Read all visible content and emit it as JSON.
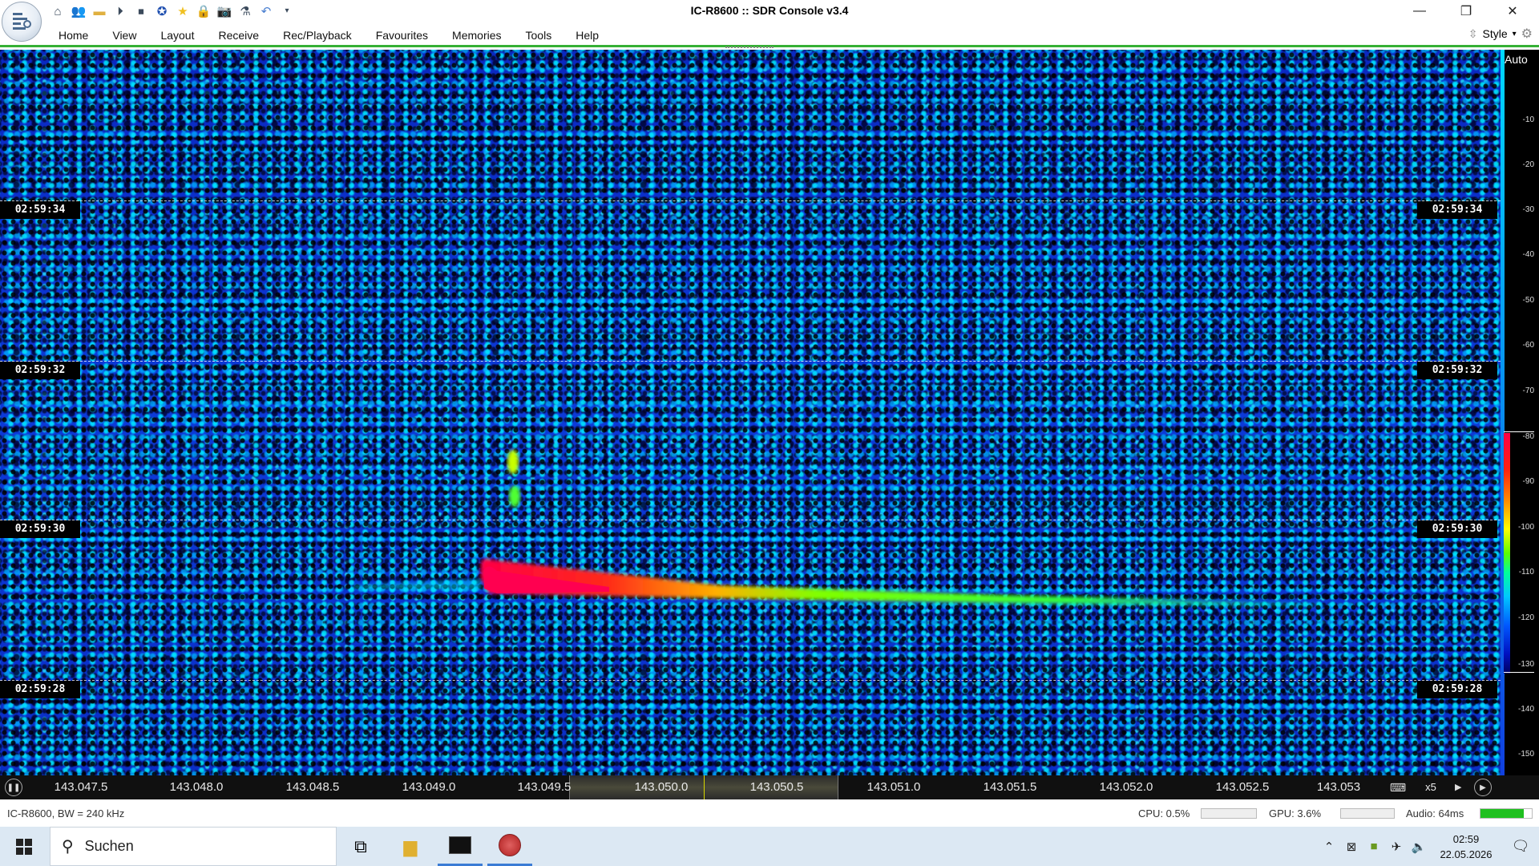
{
  "window": {
    "title": "IC-R8600 :: SDR Console v3.4",
    "minimize_icon": "minimize-icon",
    "restore_icon": "restore-icon",
    "close_icon": "close-icon"
  },
  "quick_access": {
    "icons": [
      "home-icon",
      "users-icon",
      "folder-icon",
      "play-icon",
      "stop-icon",
      "compass-icon",
      "star-icon",
      "lock-icon",
      "camera-icon",
      "flask-icon",
      "undo-icon",
      "dropdown-icon"
    ]
  },
  "menu": {
    "items": [
      "Home",
      "View",
      "Layout",
      "Receive",
      "Rec/Playback",
      "Favourites",
      "Memories",
      "Tools",
      "Help"
    ],
    "style_label": "Style"
  },
  "waterfall": {
    "time_labels": [
      "02:59:34",
      "02:59:32",
      "02:59:30",
      "02:59:28"
    ],
    "scale_mode": "Auto",
    "scale_ticks": [
      "-10",
      "-20",
      "-30",
      "-40",
      "-50",
      "-60",
      "-70",
      "-80",
      "-90",
      "-100",
      "-110",
      "-120",
      "-130",
      "-140",
      "-150"
    ],
    "colors": {
      "background": "#0a2fc8",
      "noise_light": "#00e6ff",
      "signal_peak": "#ff0044",
      "signal_tail": "#5cff00"
    }
  },
  "frequency_axis": {
    "labels": [
      "143.047.5",
      "143.048.0",
      "143.048.5",
      "143.049.0",
      "143.049.5",
      "143.050.0",
      "143.050.5",
      "143.051.0",
      "143.051.5",
      "143.052.0",
      "143.052.5",
      "143.053"
    ],
    "zoom": "x5"
  },
  "status": {
    "radio_info": "IC-R8600, BW = 240 kHz",
    "cpu": "CPU: 0.5%",
    "gpu": "GPU: 3.6%",
    "audio": "Audio: 64ms",
    "audio_level": 0.85,
    "accent_color": "#35b035"
  },
  "taskbar": {
    "search_placeholder": "Suchen",
    "time": "02:59",
    "date": "22.05.2026"
  }
}
